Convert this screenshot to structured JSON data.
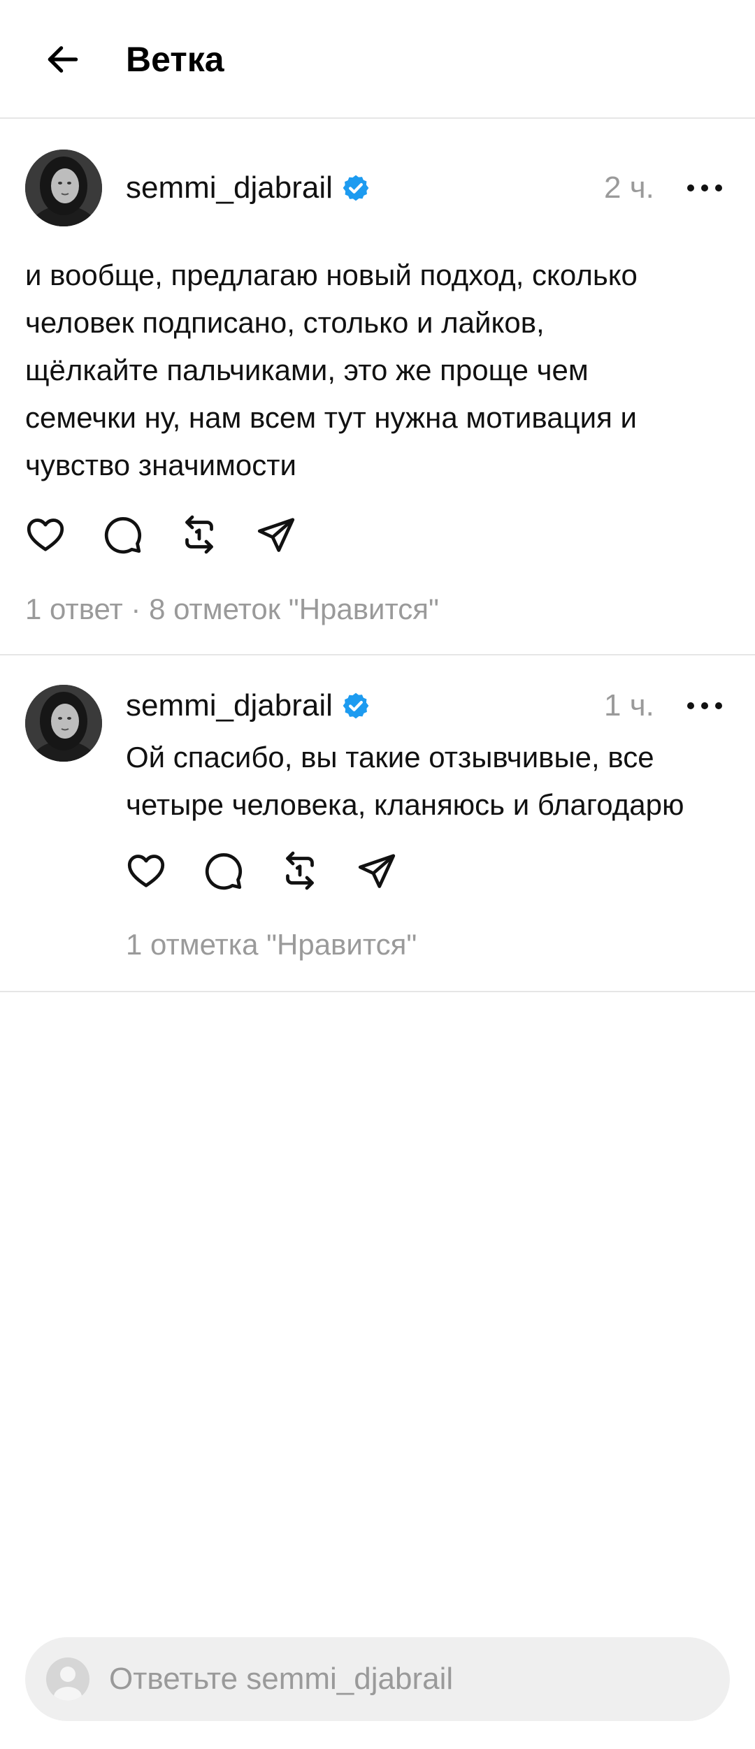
{
  "header": {
    "title": "Ветка"
  },
  "thread": {
    "main_post": {
      "username": "semmi_djabrail",
      "time": "2 ч.",
      "text": "и вообще, предлагаю новый подход, сколько\nчеловек подписано, столько и лайков,\nщёлкайте пальчиками, это же проще чем\nсемечки ну, нам всем тут нужна мотивация и\nчувство значимости",
      "replies_label": "1 ответ",
      "separator": " · ",
      "likes_label": "8 отметок \"Нравится\""
    },
    "reply_post": {
      "username": "semmi_djabrail",
      "time": "1 ч.",
      "text": "Ой спасибо, вы такие отзывчивые, все\nчетыре человека, кланяюсь и благодарю",
      "likes_label": "1 отметка \"Нравится\""
    }
  },
  "reply_bar": {
    "placeholder": "Ответьте semmi_djabrail"
  },
  "icons": {
    "back": "arrow-left-icon",
    "verified": "verified-badge-icon",
    "more": "more-horizontal-icon",
    "like": "heart-icon",
    "comment": "comment-bubble-icon",
    "repost": "repost-icon",
    "share": "send-icon"
  },
  "colors": {
    "verified": "#1d9bf0",
    "secondary_text": "#9a9a9a",
    "divider": "#e6e6e6",
    "reply_bar_bg": "#efefef"
  }
}
